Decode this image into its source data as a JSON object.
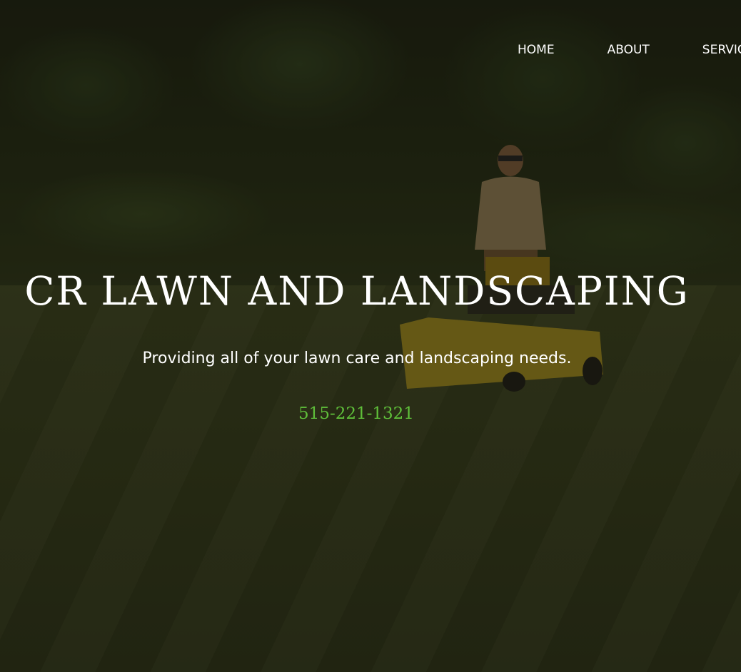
{
  "nav": {
    "items": [
      {
        "label": "HOME"
      },
      {
        "label": "ABOUT"
      },
      {
        "label": "SERVIC"
      }
    ]
  },
  "hero": {
    "title": "CR LAWN AND LANDSCAPING",
    "tagline": "Providing all of your lawn care and landscaping needs.",
    "phone": "515-221-1321"
  },
  "colors": {
    "phone_accent": "#5fbf3a",
    "text": "#ffffff",
    "overlay": "#0f0c05"
  },
  "background": {
    "description_icon": "lawn-mowing-photo"
  }
}
